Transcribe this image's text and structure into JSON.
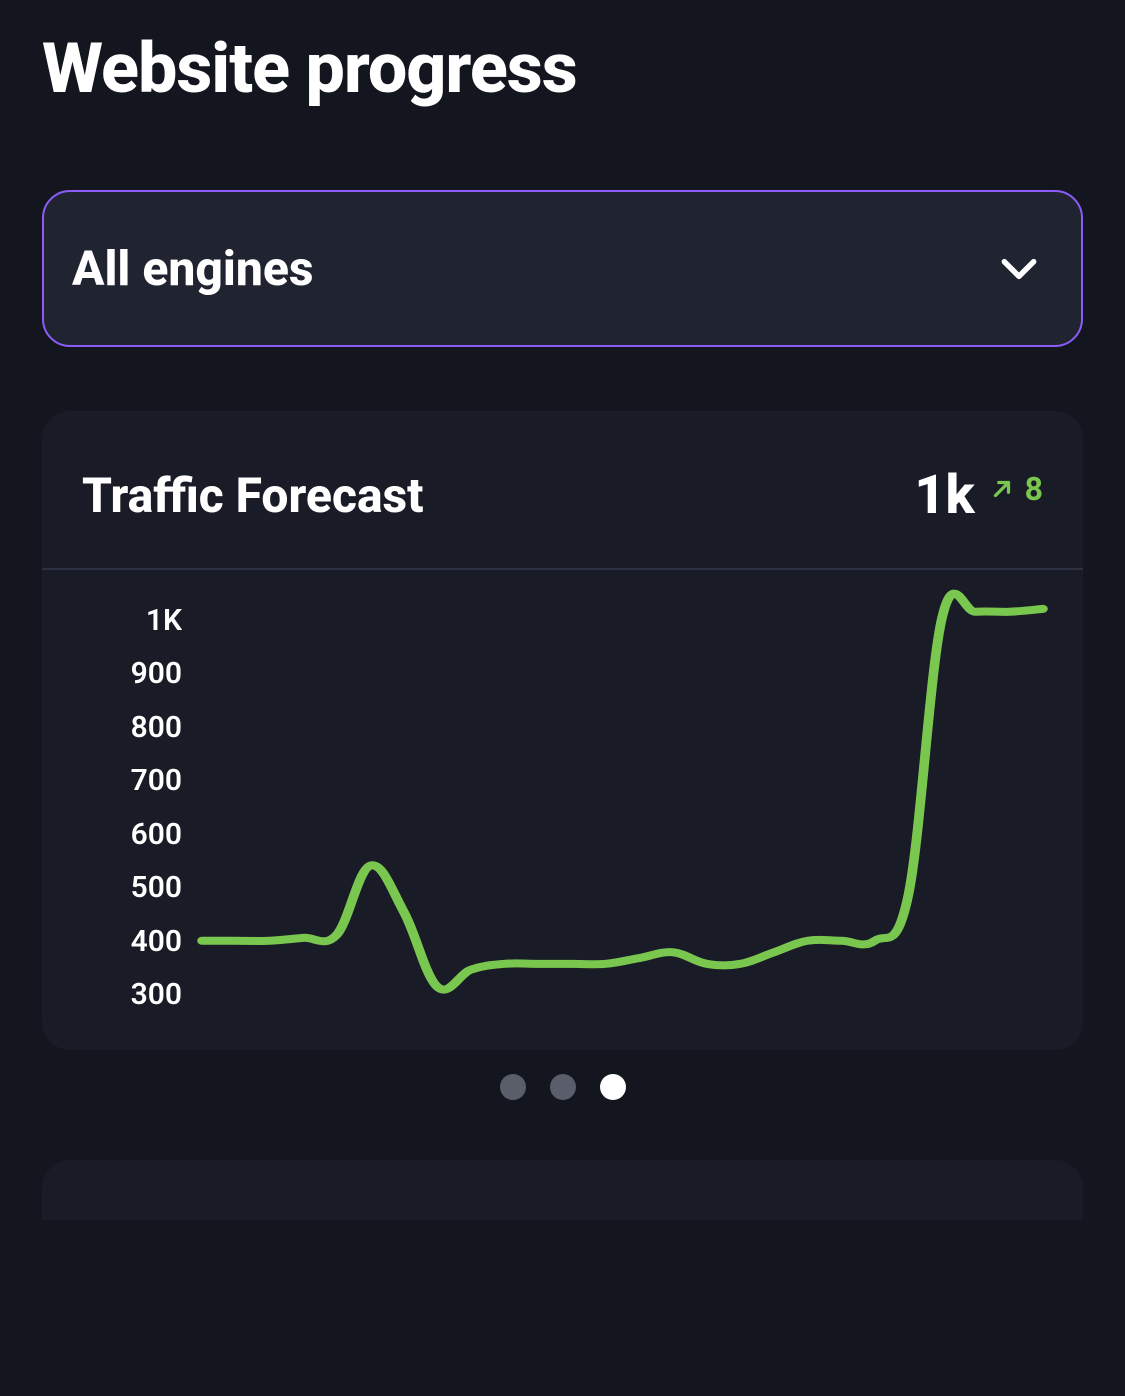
{
  "page_title": "Website progress",
  "dropdown": {
    "selected_label": "All engines"
  },
  "card": {
    "title": "Traffic Forecast",
    "metric_value": "1k",
    "trend_delta": "8",
    "trend_direction": "up"
  },
  "chart_data": {
    "type": "line",
    "title": "Traffic Forecast",
    "xlabel": "",
    "ylabel": "",
    "ylim": [
      300,
      1000
    ],
    "y_ticks": [
      "1K",
      "900",
      "800",
      "700",
      "600",
      "500",
      "400",
      "300"
    ],
    "series": [
      {
        "name": "traffic",
        "values": [
          420,
          420,
          420,
          425,
          430,
          550,
          470,
          340,
          370,
          380,
          380,
          380,
          380,
          390,
          400,
          380,
          380,
          400,
          420,
          420,
          420,
          500,
          980,
          990,
          990,
          995
        ]
      }
    ]
  },
  "pager": {
    "count": 3,
    "active_index": 2
  },
  "colors": {
    "accent_purple": "#8b5cf6",
    "accent_green": "#7ac74f"
  }
}
